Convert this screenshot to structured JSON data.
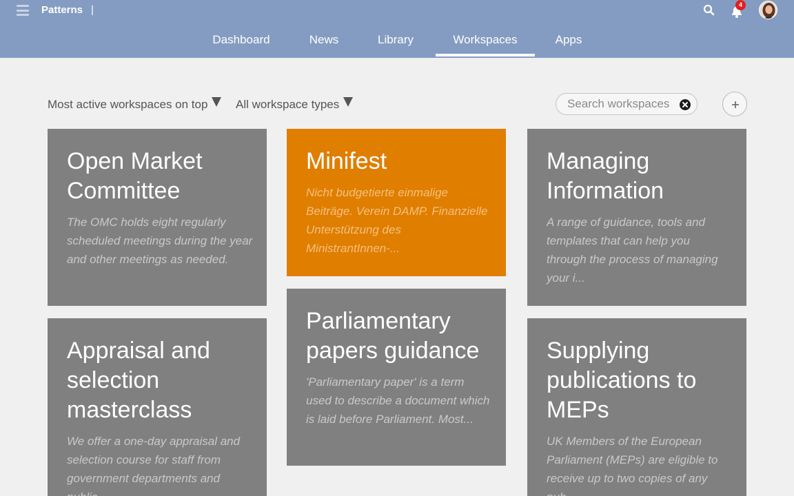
{
  "header": {
    "app_title": "Patterns",
    "title_separator": "|",
    "notification_count": "4",
    "icons": [
      "menu-icon",
      "search-icon",
      "bell-icon",
      "avatar"
    ],
    "nav": [
      {
        "label": "Dashboard",
        "active": false
      },
      {
        "label": "News",
        "active": false
      },
      {
        "label": "Library",
        "active": false
      },
      {
        "label": "Workspaces",
        "active": true
      },
      {
        "label": "Apps",
        "active": false
      }
    ]
  },
  "toolbar": {
    "sort_label": "Most active workspaces on top",
    "type_filter_label": "All workspace types",
    "search_placeholder": "Search workspaces",
    "add_label": "+"
  },
  "colors": {
    "header_bg": "#849cc1",
    "card_gray": "#808080",
    "card_orange": "#e07e00",
    "page_bg": "#f0f0f0"
  },
  "workspaces": [
    {
      "title": "Open Market Committee",
      "description": "The OMC holds eight regularly scheduled meetings during the year and other meetings as needed.",
      "color": "gray"
    },
    {
      "title": "Minifest",
      "description": "Nicht budgetierte einmalige Beiträge. Verein DAMP. Finanzielle Unterstützung des MinistrantInnen-...",
      "color": "orange"
    },
    {
      "title": "Managing Information",
      "description": "A range of guidance, tools and templates that can help you through the process of managing your i...",
      "color": "gray"
    },
    {
      "title": "Appraisal and selection masterclass",
      "description": "We offer a one-day appraisal and selection course for staff from government departments and public",
      "color": "gray"
    },
    {
      "title": "Parliamentary papers guidance",
      "description": "'Parliamentary paper' is a term used to describe a document which is laid before Parliament. Most...",
      "color": "gray"
    },
    {
      "title": "Supplying publications to MEPs",
      "description": "UK Members of the European Parliament (MEPs) are eligible to receive up to two copies of any pub...",
      "color": "gray"
    }
  ]
}
